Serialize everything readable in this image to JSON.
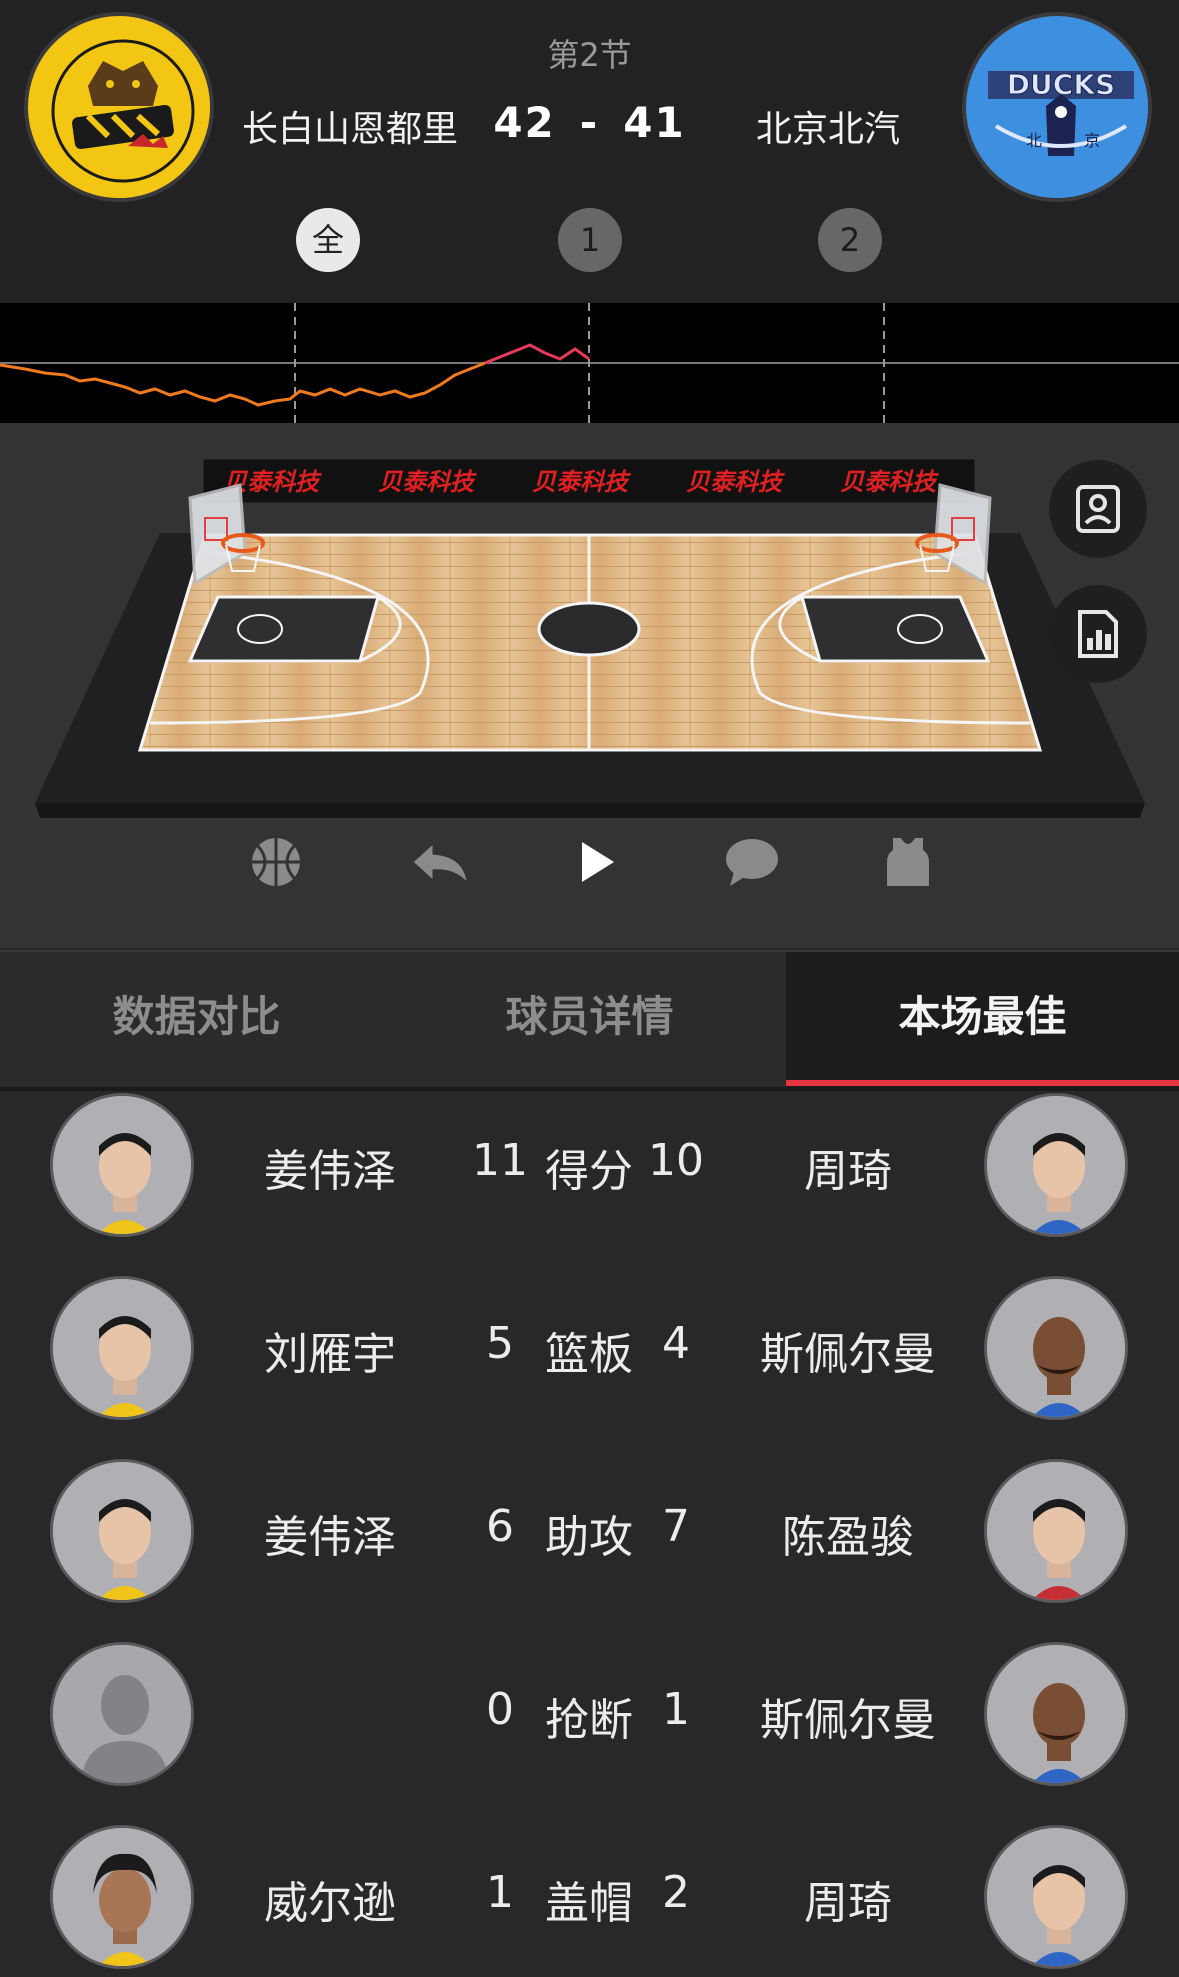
{
  "header": {
    "period": "第2节",
    "home_team": "长白山恩都里",
    "away_team": "北京北汽",
    "home_score": "42",
    "score_separator": "-",
    "away_score": "41",
    "quarter_buttons": [
      "全",
      "1",
      "2"
    ]
  },
  "court": {
    "sponsor_text": "贝泰科技",
    "sponsor_boards": [
      "贝泰科技",
      "贝泰科技",
      "贝泰科技",
      "贝泰科技",
      "贝泰科技"
    ]
  },
  "side_buttons": [
    {
      "icon": "player-card-icon"
    },
    {
      "icon": "stats-chart-icon"
    }
  ],
  "toolbar": [
    "basketball-icon",
    "undo-icon",
    "play-icon",
    "comment-icon",
    "jersey-icon"
  ],
  "tabs": {
    "compare": "数据对比",
    "players": "球员详情",
    "best": "本场最佳"
  },
  "best_rows": [
    {
      "left_name": "姜伟泽",
      "left_value": "11",
      "label": "得分",
      "right_value": "10",
      "right_name": "周琦"
    },
    {
      "left_name": "刘雁宇",
      "left_value": "5",
      "label": "篮板",
      "right_value": "4",
      "right_name": "斯佩尔曼"
    },
    {
      "left_name": "姜伟泽",
      "left_value": "6",
      "label": "助攻",
      "right_value": "7",
      "right_name": "陈盈骏"
    },
    {
      "left_name": "",
      "left_value": "0",
      "label": "抢断",
      "right_value": "1",
      "right_name": "斯佩尔曼"
    },
    {
      "left_name": "威尔逊",
      "left_value": "1",
      "label": "盖帽",
      "right_value": "2",
      "right_name": "周琦"
    }
  ],
  "colors": {
    "accent": "#e8343e",
    "trend_home": "#f07a1c",
    "trend_away": "#e63a58"
  }
}
